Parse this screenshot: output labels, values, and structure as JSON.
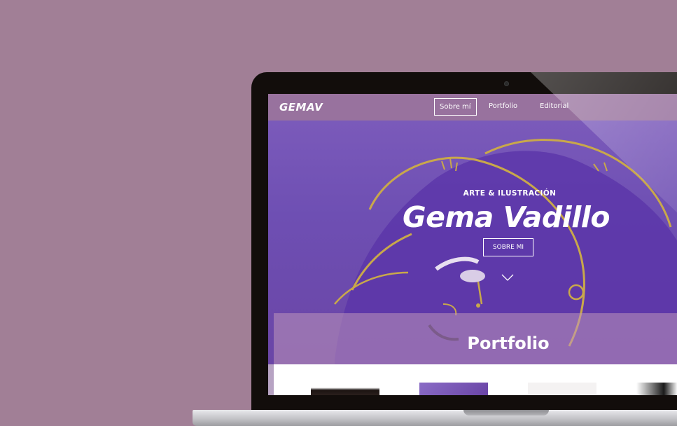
{
  "site": {
    "logo": "GEMAV",
    "nav": [
      "Sobre mí",
      "Portfolio",
      "Editorial"
    ],
    "active_nav": "Sobre mí"
  },
  "hero": {
    "eyebrow": "ARTE & ILUSTRACIÓN",
    "title": "Gema Vadillo",
    "button": "SOBRE MI",
    "scroll_icon": "chevron-down-icon"
  },
  "portfolio": {
    "title": "Portfolio"
  },
  "colors": {
    "background": "#a17f96",
    "hero_purple": "#7e5dbc",
    "accent_gold": "#c9a84a"
  }
}
